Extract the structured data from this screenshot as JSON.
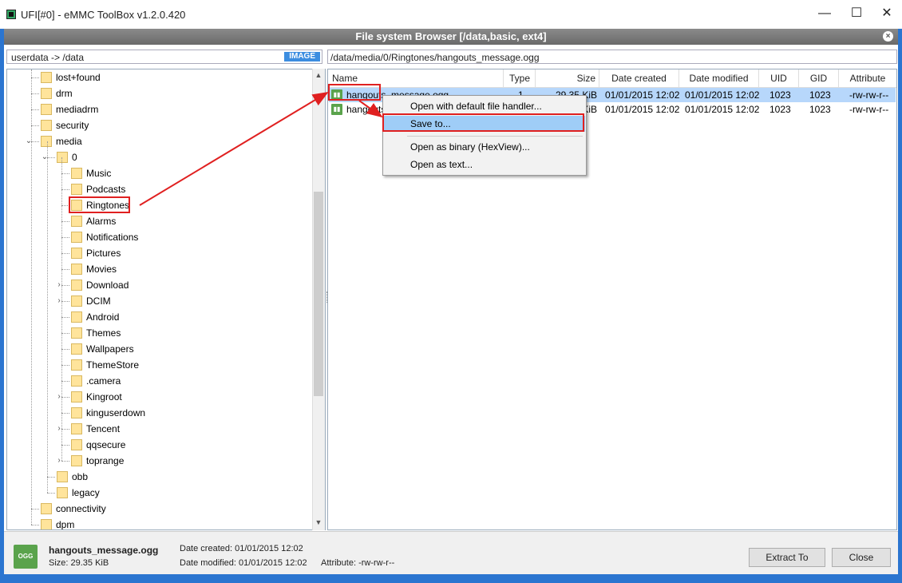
{
  "window": {
    "title": "UFI[#0] - eMMC ToolBox v1.2.0.420",
    "minimize": "—",
    "maximize": "☐",
    "close": "✕"
  },
  "header": {
    "title": "File system Browser [/data,basic, ext4]",
    "close": "×"
  },
  "left_path": {
    "text": "userdata -> /data",
    "badge": "IMAGE"
  },
  "right_path": {
    "text": "/data/media/0/Ringtones/hangouts_message.ogg"
  },
  "tree": {
    "items": [
      {
        "label": "lost+found",
        "level": 1,
        "expander": ""
      },
      {
        "label": "drm",
        "level": 1,
        "expander": ""
      },
      {
        "label": "mediadrm",
        "level": 1,
        "expander": ""
      },
      {
        "label": "security",
        "level": 1,
        "expander": ""
      },
      {
        "label": "media",
        "level": 1,
        "expander": "v"
      },
      {
        "label": "0",
        "level": 2,
        "expander": "v"
      },
      {
        "label": "Music",
        "level": 3,
        "expander": ""
      },
      {
        "label": "Podcasts",
        "level": 3,
        "expander": ""
      },
      {
        "label": "Ringtones",
        "level": 3,
        "expander": ""
      },
      {
        "label": "Alarms",
        "level": 3,
        "expander": ""
      },
      {
        "label": "Notifications",
        "level": 3,
        "expander": ""
      },
      {
        "label": "Pictures",
        "level": 3,
        "expander": ""
      },
      {
        "label": "Movies",
        "level": 3,
        "expander": ""
      },
      {
        "label": "Download",
        "level": 3,
        "expander": ">"
      },
      {
        "label": "DCIM",
        "level": 3,
        "expander": ">"
      },
      {
        "label": "Android",
        "level": 3,
        "expander": ""
      },
      {
        "label": "Themes",
        "level": 3,
        "expander": ""
      },
      {
        "label": "Wallpapers",
        "level": 3,
        "expander": ""
      },
      {
        "label": "ThemeStore",
        "level": 3,
        "expander": ""
      },
      {
        "label": ".camera",
        "level": 3,
        "expander": ""
      },
      {
        "label": "Kingroot",
        "level": 3,
        "expander": ">"
      },
      {
        "label": "kinguserdown",
        "level": 3,
        "expander": ""
      },
      {
        "label": "Tencent",
        "level": 3,
        "expander": ">"
      },
      {
        "label": "qqsecure",
        "level": 3,
        "expander": ""
      },
      {
        "label": "toprange",
        "level": 3,
        "expander": ">"
      },
      {
        "label": "obb",
        "level": 2,
        "expander": ""
      },
      {
        "label": "legacy",
        "level": 2,
        "expander": ""
      },
      {
        "label": "connectivity",
        "level": 1,
        "expander": ""
      },
      {
        "label": "dpm",
        "level": 1,
        "expander": ""
      }
    ]
  },
  "file_list": {
    "columns": [
      "Name",
      "Type",
      "Size",
      "Date created",
      "Date modified",
      "UID",
      "GID",
      "Attribute"
    ],
    "rows": [
      {
        "name": "hangouts_message.ogg",
        "type": "1",
        "size": "29.35 KiB",
        "created": "01/01/2015 12:02",
        "modified": "01/01/2015 12:02",
        "uid": "1023",
        "gid": "1023",
        "attr": "-rw-rw-r--"
      },
      {
        "name": "hangouts_video_call.ogg",
        "type": "1",
        "size": "KiB",
        "created": "01/01/2015 12:02",
        "modified": "01/01/2015 12:02",
        "uid": "1023",
        "gid": "1023",
        "attr": "-rw-rw-r--"
      }
    ]
  },
  "context_menu": {
    "items": [
      "Open with default file handler...",
      "Save to...",
      "Open as binary (HexView)...",
      "Open as text..."
    ]
  },
  "status": {
    "icon_text": "OGG",
    "filename": "hangouts_message.ogg",
    "size": "Size: 29.35 KiB",
    "created": "Date created: 01/01/2015 12:02",
    "modified": "Date modified: 01/01/2015 12:02",
    "attribute": "Attribute: -rw-rw-r--",
    "extract_label": "Extract To",
    "close_label": "Close"
  },
  "colors": {
    "accent": "#2b75d0",
    "selection": "#b7d7fb",
    "annotation": "#e02020"
  }
}
